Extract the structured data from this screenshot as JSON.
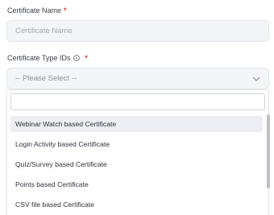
{
  "certificate_name": {
    "label": "Certificate Name",
    "required_mark": "*",
    "placeholder": "Certificate Name",
    "value": ""
  },
  "certificate_type": {
    "label": "Certificate Type IDs",
    "required_mark": "*",
    "info_icon": "info-circle-icon",
    "selected": "-- Please Select --",
    "chevron_icon": "chevron-down-icon",
    "search_value": "",
    "options": [
      "Webinar Watch based Certificate",
      "Login Activity based Certificate",
      "Quiz/Survey based Certificate",
      "Points based Certificate",
      "CSV file based Certificate"
    ],
    "highlighted_option_index": 0
  },
  "colors": {
    "required": "#e23b3b",
    "input_bg": "#f4f5f8",
    "highlight_bg": "#eceef3"
  }
}
